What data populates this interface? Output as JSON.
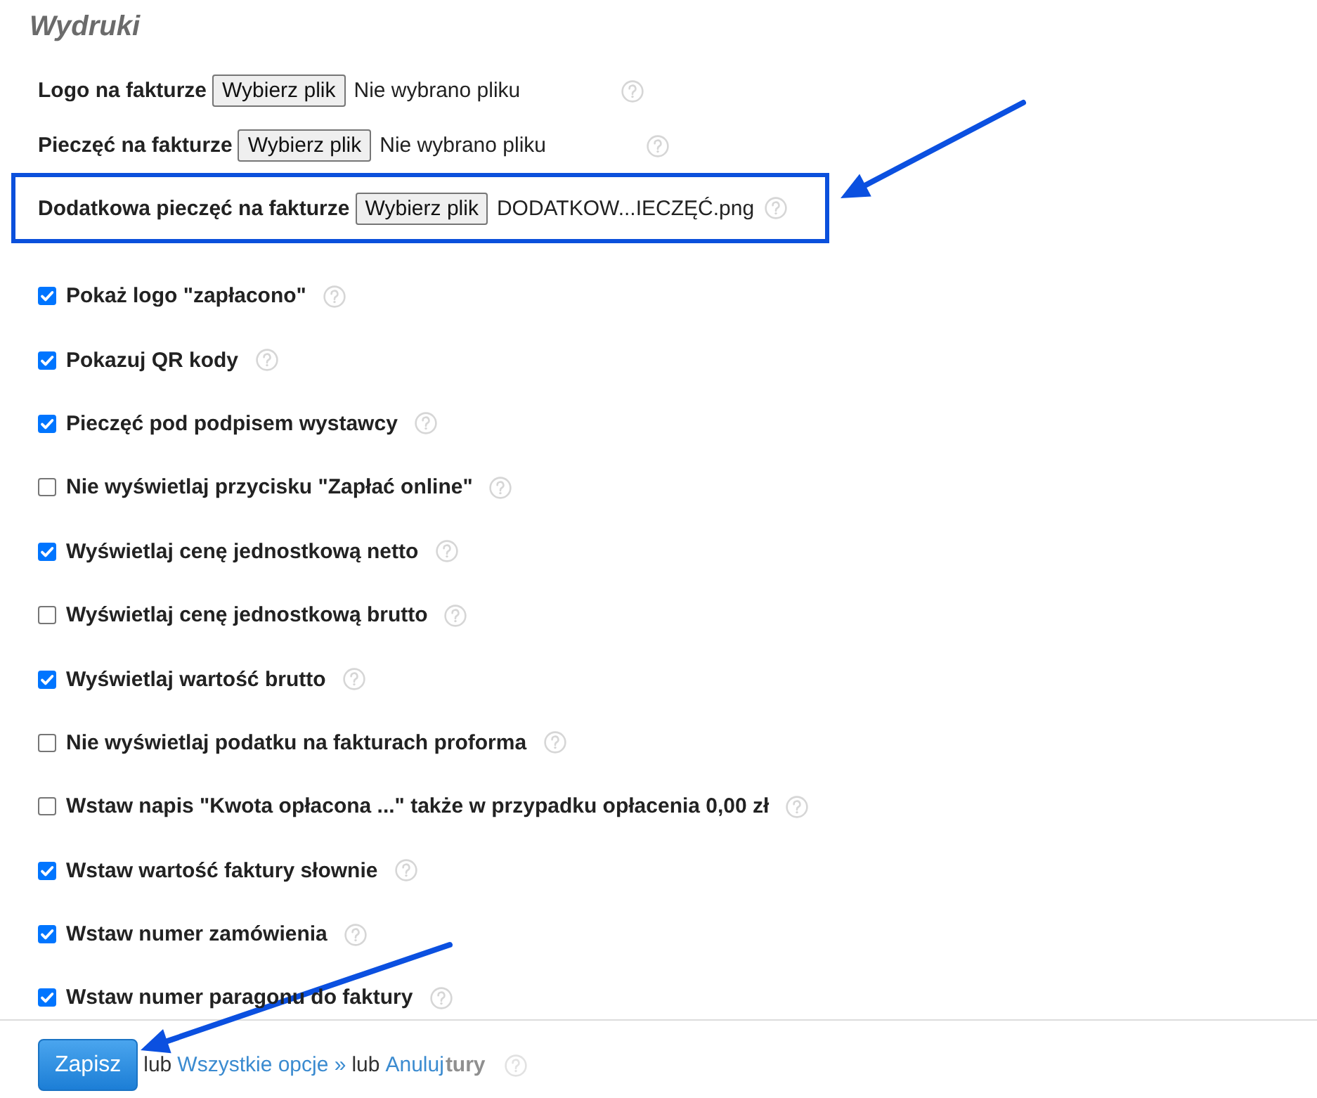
{
  "section": {
    "title": "Wydruki"
  },
  "file_fields": [
    {
      "label": "Logo na fakturze",
      "button": "Wybierz plik",
      "status": "Nie wybrano pliku",
      "highlighted": false
    },
    {
      "label": "Pieczęć na fakturze",
      "button": "Wybierz plik",
      "status": "Nie wybrano pliku",
      "highlighted": false
    },
    {
      "label": "Dodatkowa pieczęć na fakturze",
      "button": "Wybierz plik",
      "status": "DODATKOW...IECZĘĆ.png",
      "highlighted": true
    }
  ],
  "options": [
    {
      "label": "Pokaż logo \"zapłacono\"",
      "checked": true
    },
    {
      "label": "Pokazuj QR kody",
      "checked": true
    },
    {
      "label": "Pieczęć pod podpisem wystawcy",
      "checked": true
    },
    {
      "label": "Nie wyświetlaj przycisku \"Zapłać online\"",
      "checked": false
    },
    {
      "label": "Wyświetlaj cenę jednostkową netto",
      "checked": true
    },
    {
      "label": "Wyświetlaj cenę jednostkową brutto",
      "checked": false
    },
    {
      "label": "Wyświetlaj wartość brutto",
      "checked": true
    },
    {
      "label": "Nie wyświetlaj podatku na fakturach proforma",
      "checked": false
    },
    {
      "label": "Wstaw napis \"Kwota opłacona ...\" także w przypadku opłacenia 0,00 zł",
      "checked": false
    },
    {
      "label": "Wstaw wartość faktury słownie",
      "checked": true
    },
    {
      "label": "Wstaw numer zamówienia",
      "checked": true
    },
    {
      "label": "Wstaw numer paragonu do faktury",
      "checked": true
    }
  ],
  "footer": {
    "save_button": "Zapisz",
    "separator_1": "lub",
    "all_options_link": "Wszystkie opcje »",
    "separator_2": "lub",
    "cancel_link": "Anuluj",
    "covered_option_text": "tury"
  }
}
